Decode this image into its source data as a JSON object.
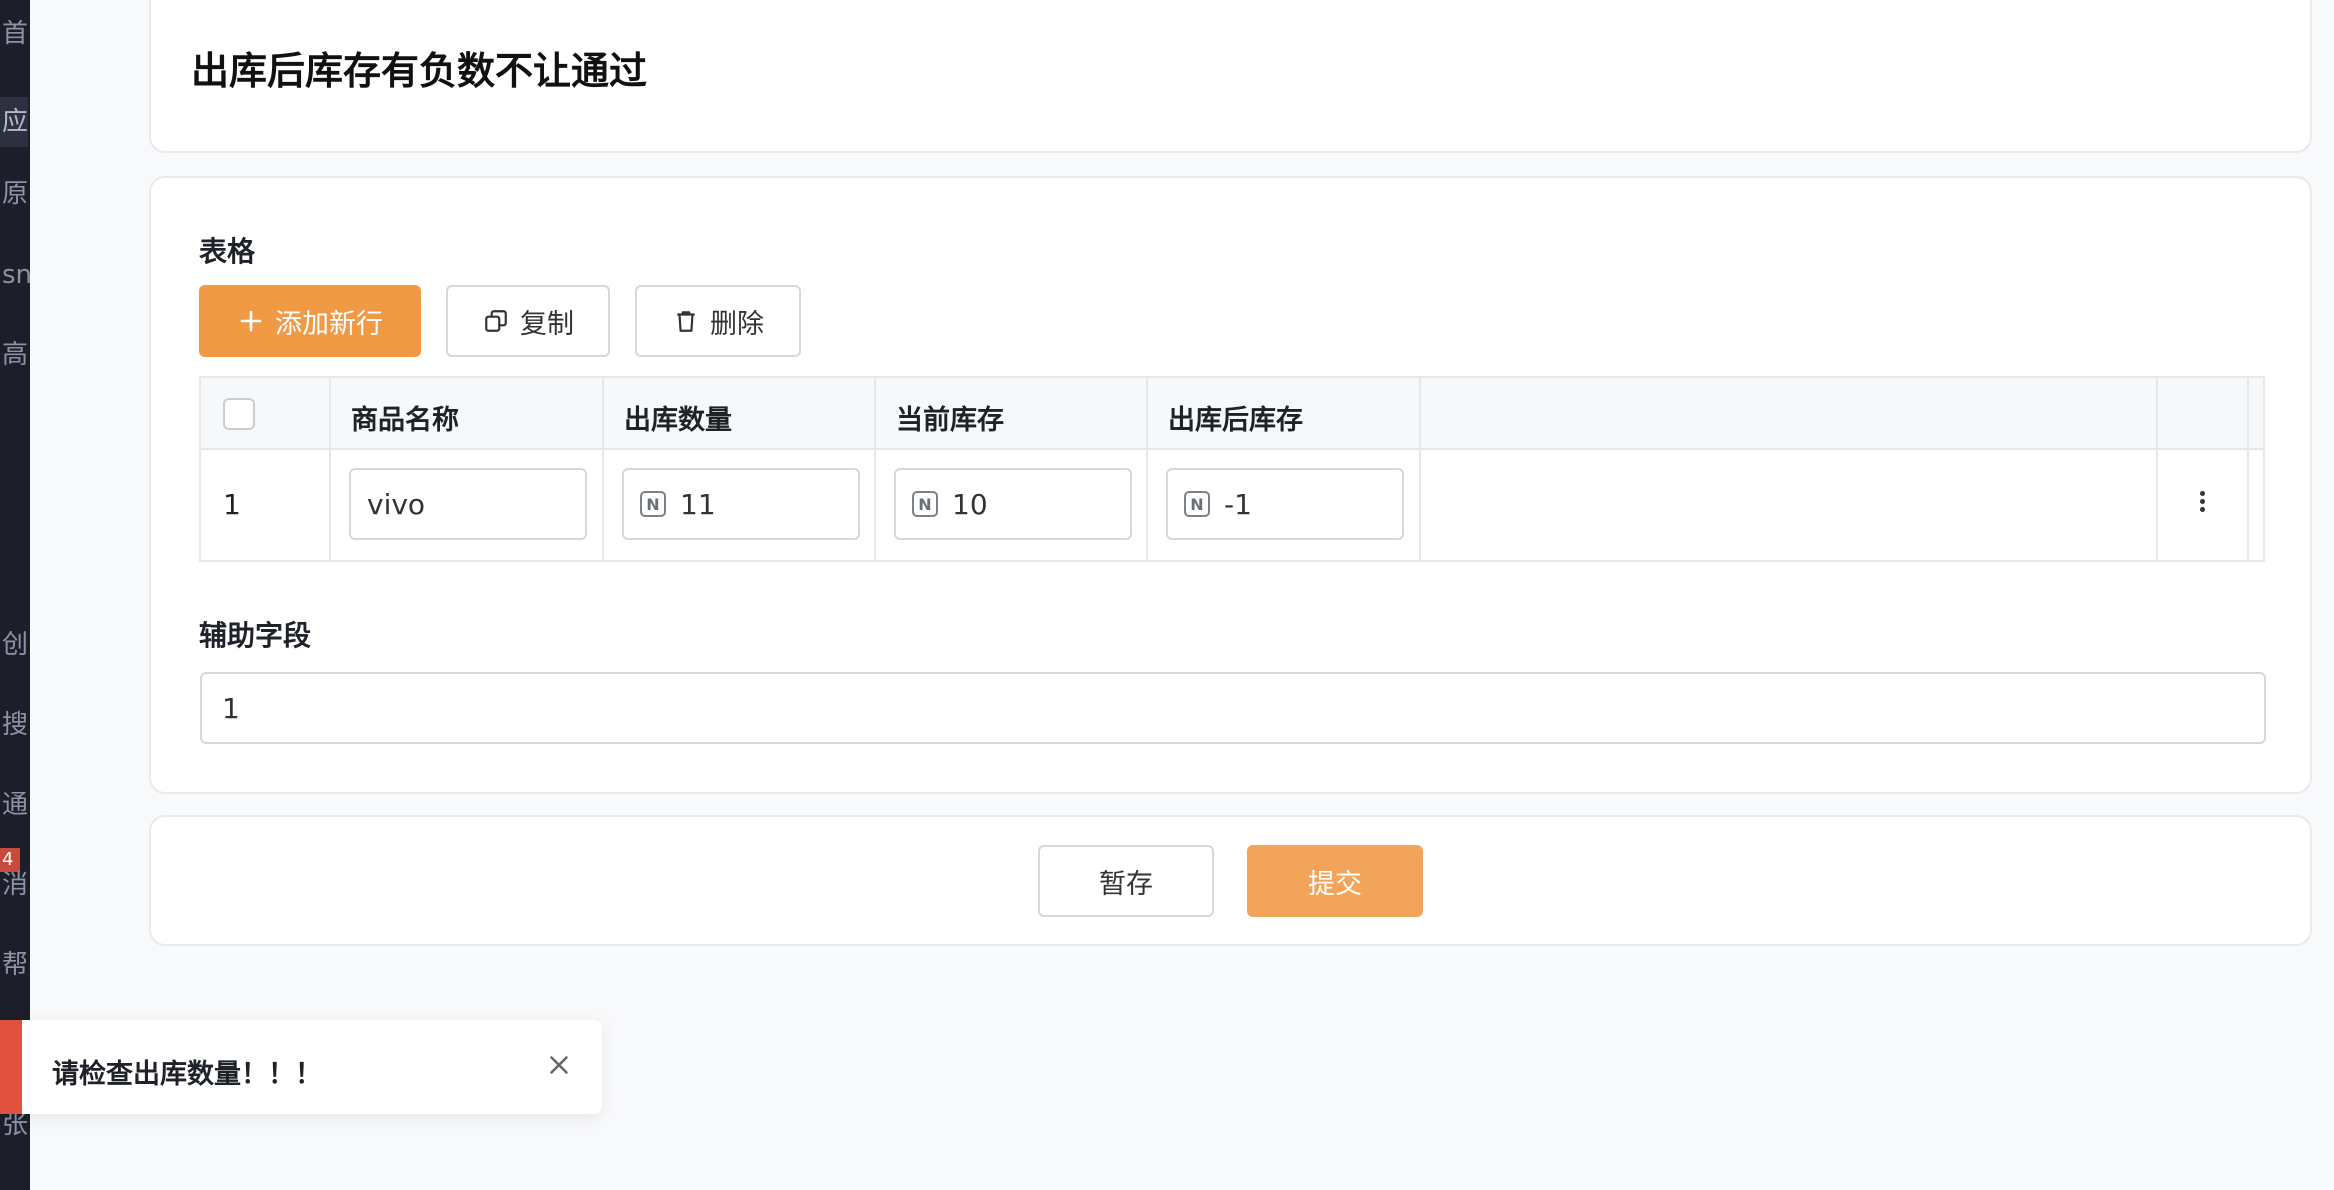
{
  "sidebar": {
    "items": [
      "首",
      "应",
      "原",
      "sn",
      "高",
      "创",
      "搜",
      "通",
      "消",
      "帮",
      "张"
    ],
    "badge": "4"
  },
  "page": {
    "title": "出库后库存有负数不让通过"
  },
  "form": {
    "table_section_label": "表格",
    "toolbar": {
      "add_row_label": "添加新行",
      "copy_label": "复制",
      "delete_label": "删除"
    },
    "table": {
      "columns": [
        "商品名称",
        "出库数量",
        "当前库存",
        "出库后库存"
      ],
      "rows": [
        {
          "index": "1",
          "product_name": "vivo",
          "outbound_qty": "11",
          "current_stock": "10",
          "stock_after": "-1"
        }
      ]
    },
    "aux_section_label": "辅助字段",
    "aux_value": "1"
  },
  "actions": {
    "save_draft_label": "暂存",
    "submit_label": "提交"
  },
  "toast": {
    "message": "请检查出库数量！！！"
  },
  "colors": {
    "primary": "#f09a45",
    "error": "#e0513f",
    "sidebar_bg": "#1c1e2a"
  }
}
